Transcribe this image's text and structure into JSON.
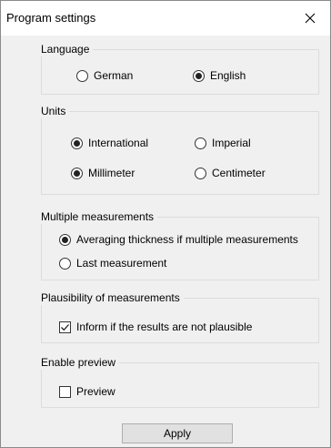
{
  "window": {
    "title": "Program settings",
    "close_icon": "close-icon"
  },
  "language": {
    "label": "Language",
    "options": [
      {
        "label": "German",
        "checked": false
      },
      {
        "label": "English",
        "checked": true
      }
    ]
  },
  "units": {
    "label": "Units",
    "options": [
      {
        "label": "International",
        "checked": true
      },
      {
        "label": "Imperial",
        "checked": false
      },
      {
        "label": "Millimeter",
        "checked": true
      },
      {
        "label": "Centimeter",
        "checked": false
      }
    ]
  },
  "multiple": {
    "label": "Multiple measurements",
    "options": [
      {
        "label": "Averaging thickness if multiple measurements",
        "checked": true
      },
      {
        "label": "Last measurement",
        "checked": false
      }
    ]
  },
  "plausibility": {
    "label": "Plausibility of measurements",
    "checkbox": {
      "label": "Inform if the results are not plausible",
      "checked": true
    }
  },
  "preview": {
    "label": "Enable preview",
    "checkbox": {
      "label": "Preview",
      "checked": false
    }
  },
  "footer": {
    "apply_label": "Apply"
  }
}
